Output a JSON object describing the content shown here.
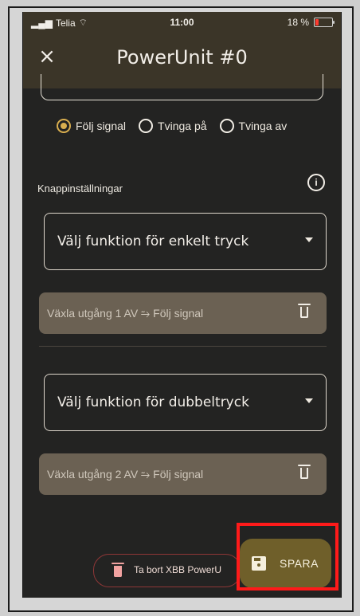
{
  "status": {
    "carrier": "Telia",
    "time": "11:00",
    "battery": "18 %"
  },
  "header": {
    "title": "PowerUnit #0"
  },
  "signal_mode": {
    "options": [
      {
        "label": "Följ signal",
        "selected": true
      },
      {
        "label": "Tvinga på",
        "selected": false
      },
      {
        "label": "Tvinga av",
        "selected": false
      }
    ]
  },
  "button_settings": {
    "title": "Knappinställningar"
  },
  "single_press": {
    "placeholder": "Välj funktion för enkelt tryck",
    "assigned": "Växla utgång 1 AV ⥲ Följ signal"
  },
  "double_press": {
    "placeholder": "Välj funktion för dubbeltryck",
    "assigned": "Växla utgång 2 AV ⥲ Följ signal"
  },
  "actions": {
    "delete": "Ta bort XBB PowerU",
    "save": "SPARA"
  }
}
